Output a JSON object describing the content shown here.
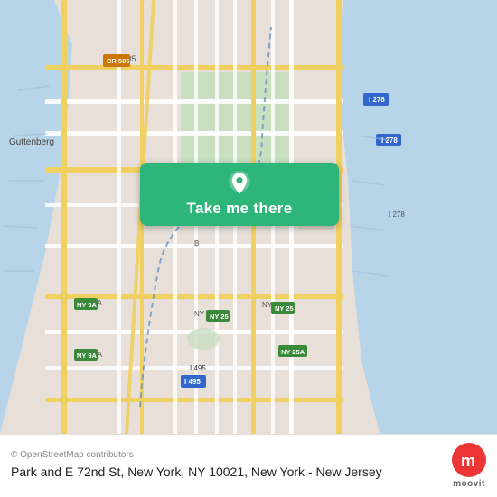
{
  "map": {
    "attribution": "© OpenStreetMap contributors",
    "center_lat": 40.7721,
    "center_lng": -73.9627,
    "zoom": 13
  },
  "button": {
    "label": "Take me there"
  },
  "info_bar": {
    "attribution": "© OpenStreetMap contributors",
    "location": "Park and E 72nd St, New York, NY 10021, New York - New Jersey"
  },
  "moovit": {
    "label": "moovit",
    "icon": "m"
  },
  "colors": {
    "green_btn": "#2db57a",
    "map_bg": "#e8e0d8",
    "water": "#b8d4e8",
    "road_yellow": "#f0d060",
    "road_white": "#ffffff",
    "park_green": "#c8dfc8",
    "moovit_red": "#ee3535"
  }
}
